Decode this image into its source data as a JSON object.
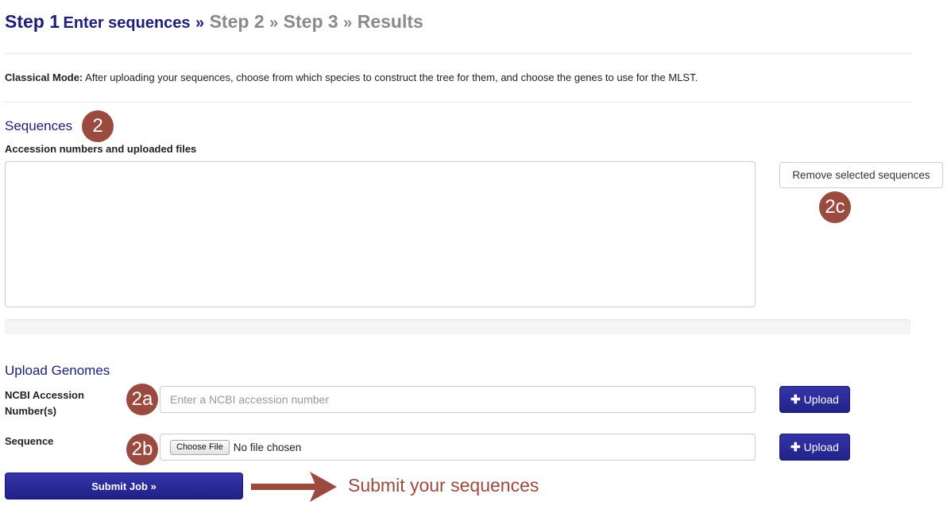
{
  "wizard": {
    "step1_num": "Step 1",
    "step1_label": "Enter sequences",
    "sep": "»",
    "step2": "Step 2",
    "step3": "Step 3",
    "results": "Results"
  },
  "mode": {
    "title": "Classical Mode:",
    "description": " After uploading your sequences, choose from which species to construct the tree for them, and choose the genes to use for the MLST."
  },
  "sequences": {
    "title": "Sequences",
    "subtitle": "Accession numbers and uploaded files",
    "remove_button": "Remove selected sequences",
    "progress": 0
  },
  "upload": {
    "title": "Upload Genomes",
    "ncbi_label": "NCBI Accession Number(s)",
    "ncbi_placeholder": "Enter a NCBI accession number",
    "ncbi_upload_button": "Upload",
    "sequence_label": "Sequence",
    "choose_file_button": "Choose File",
    "file_status": "No file chosen",
    "sequence_upload_button": "Upload",
    "upload_icon": "plus-icon"
  },
  "submit": {
    "button": "Submit Job »"
  },
  "annotations": {
    "badge_2": "2",
    "badge_2a": "2a",
    "badge_2b": "2b",
    "badge_2c": "2c",
    "arrow_text": "Submit your sequences",
    "color": "#9a4a3f"
  },
  "colors": {
    "primary": "#1e1e7a",
    "inactive_step": "#8a8a8a",
    "annotation": "#9a4a3f"
  }
}
